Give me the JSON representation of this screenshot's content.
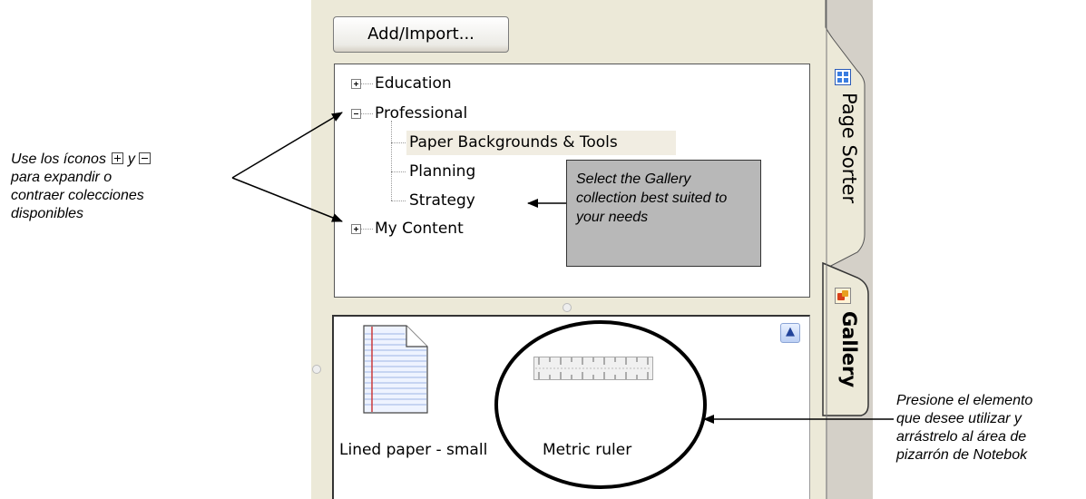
{
  "annotations": {
    "left": {
      "prefix": "Use los íconos",
      "middle": "y",
      "rest": [
        "para expandir o",
        "contraer colecciones",
        "disponibles"
      ]
    },
    "right": [
      "Presione el elemento",
      "que desee utilizar y",
      "arrástrelo al área de",
      "pizarrón de Notebok"
    ],
    "callout": "Select the Gallery collection best suited to your needs"
  },
  "toolbar": {
    "add_import_label": "Add/Import..."
  },
  "tree": {
    "education": "Education",
    "professional": "Professional",
    "paper_backgrounds": "Paper Backgrounds & Tools",
    "planning": "Planning",
    "strategy": "Strategy",
    "my_content": "My Content",
    "selected": "Paper Backgrounds & Tools"
  },
  "gallery_items": {
    "lined_paper": "Lined paper - small",
    "metric_ruler": "Metric ruler"
  },
  "side_tabs": {
    "page_sorter": "Page Sorter",
    "gallery": "Gallery",
    "active": "Gallery"
  },
  "icons": [
    "plus-icon",
    "minus-icon",
    "page-sorter-icon",
    "gallery-icon",
    "scroll-up-icon",
    "lined-paper-icon",
    "metric-ruler-icon"
  ]
}
